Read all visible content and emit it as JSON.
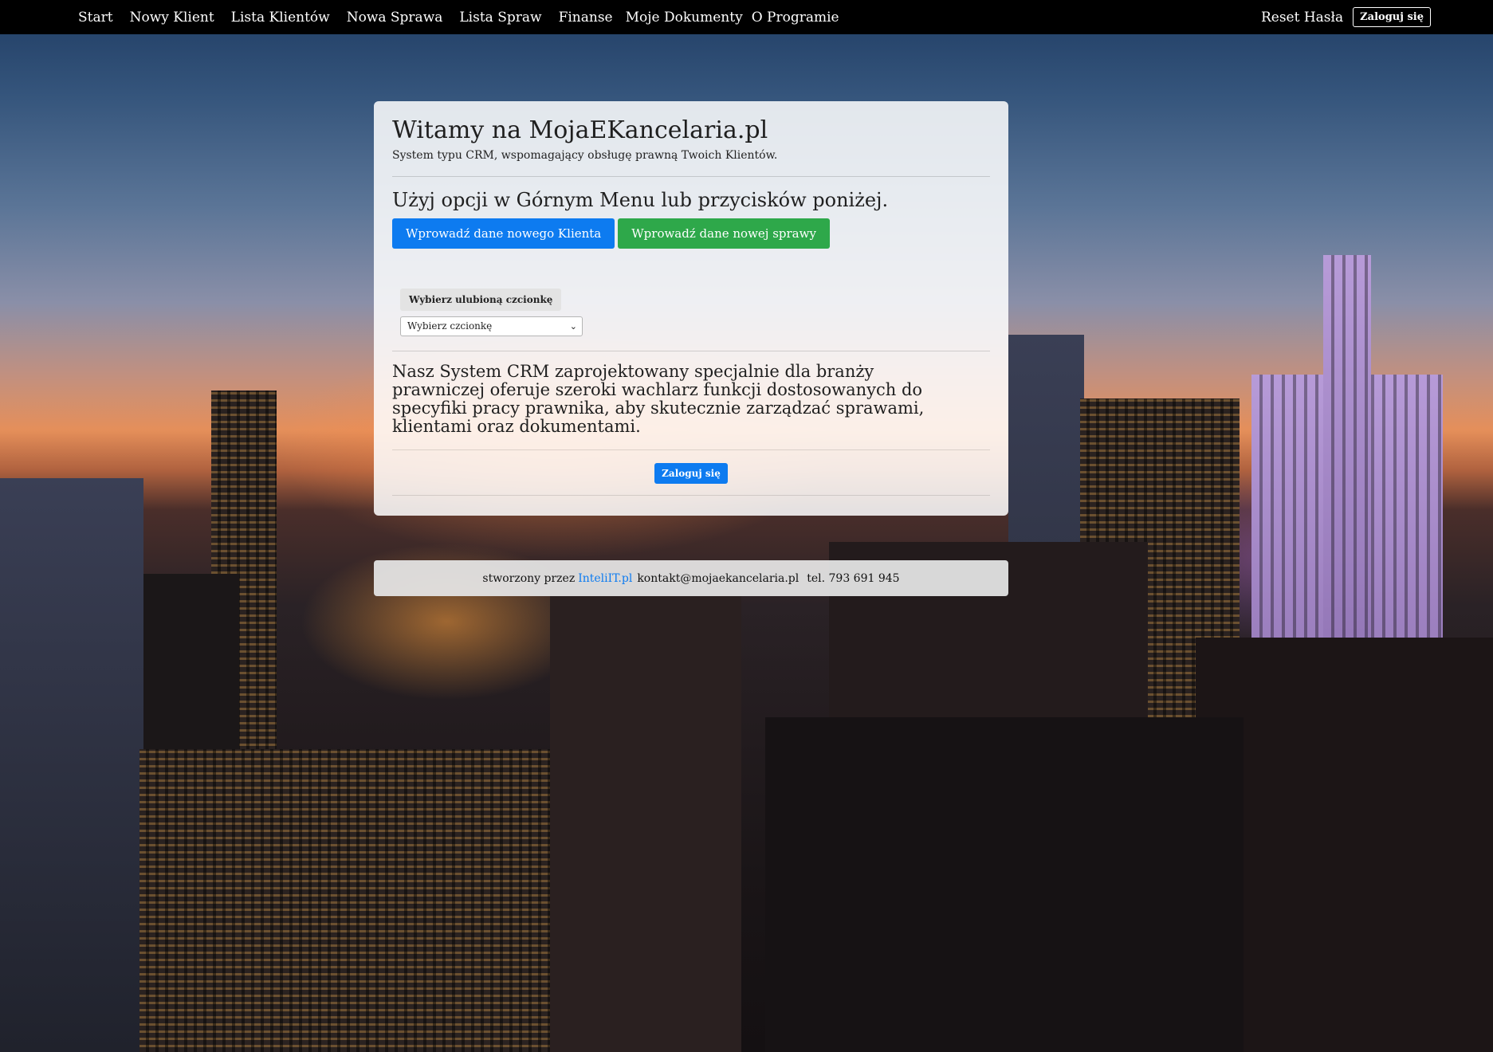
{
  "nav": {
    "items": [
      {
        "label": "Start"
      },
      {
        "label": "Nowy Klient"
      },
      {
        "label": "Lista Klientów"
      },
      {
        "label": "Nowa Sprawa"
      },
      {
        "label": "Lista Spraw"
      },
      {
        "label": "Finanse"
      },
      {
        "label": "Moje Dokumenty"
      },
      {
        "label": "O Programie"
      }
    ],
    "reset_label": "Reset Hasła",
    "login_label": "Zaloguj się"
  },
  "main": {
    "title": "Witamy na MojaEKancelaria.pl",
    "subtitle": "System typu CRM, wspomagający obsługę prawną Twoich Klientów.",
    "prompt": "Użyj opcji w Górnym Menu lub przycisków poniżej.",
    "new_client_button": "Wprowadź dane nowego Klienta",
    "new_case_button": "Wprowadź dane nowej sprawy",
    "font_label": "Wybierz ulubioną czcionkę",
    "font_select_value": "Wybierz czcionkę",
    "description": "Nasz System CRM zaprojektowany specjalnie dla branży prawniczej oferuje szeroki wachlarz funkcji dostosowanych do specyfiki pracy prawnika, aby skutecznie zarządzać sprawami, klientami oraz dokumentami.",
    "login_button": "Zaloguj się"
  },
  "footer": {
    "prefix": "stworzony przez",
    "company_link": "InteliIT.pl",
    "email": "kontakt@mojaekancelaria.pl",
    "phone": "tel. 793 691 945"
  },
  "colors": {
    "navbar": "#000000",
    "primary": "#0d7bf0",
    "success": "#2ea84a"
  }
}
